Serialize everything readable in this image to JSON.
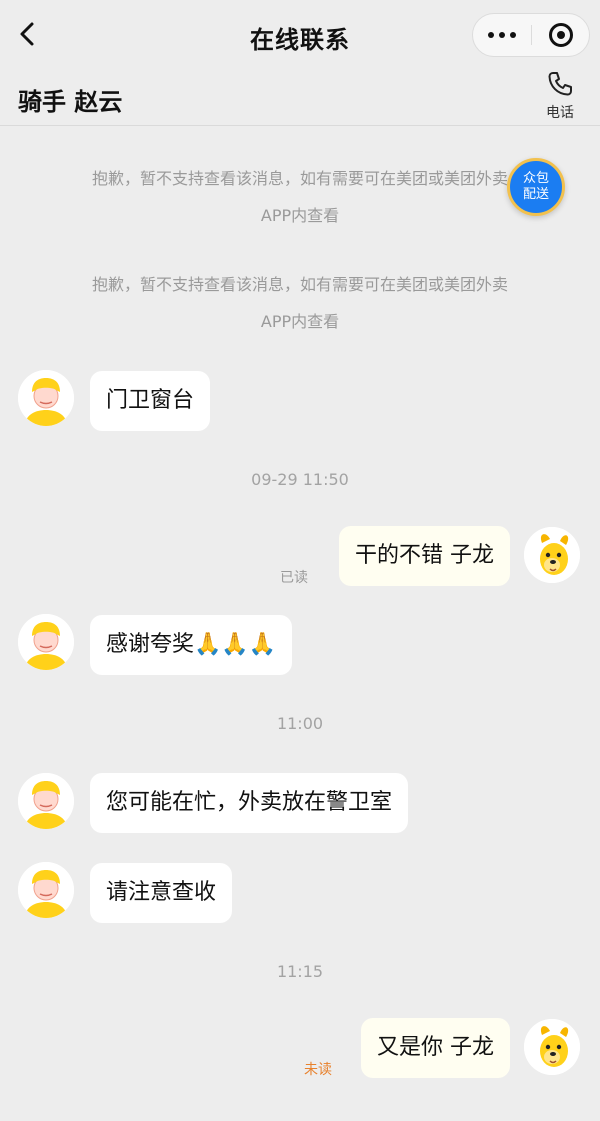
{
  "nav": {
    "title": "在线联系",
    "back_icon": "chevron-left-icon",
    "more_icon": "more-dots-icon",
    "close_icon": "target-close-icon"
  },
  "header": {
    "rider_name": "骑手 赵云",
    "phone_label": "电话",
    "phone_icon": "phone-icon"
  },
  "float_badge": {
    "line1": "众包",
    "line2": "配送",
    "color": "#1b7df2"
  },
  "system_messages": [
    {
      "line1": "抱歉，暂不支持查看该消息，如有需要可在美团或美团外卖",
      "line2": "APP内查看"
    },
    {
      "line1": "抱歉，暂不支持查看该消息，如有需要可在美团或美团外卖",
      "line2": "APP内查看"
    }
  ],
  "timestamps": [
    "09-29 11:50",
    "11:00",
    "11:15"
  ],
  "messages": [
    {
      "sender": "rider",
      "text": "门卫窗台"
    },
    {
      "sender": "me",
      "text": "干的不错 子龙",
      "status": "已读"
    },
    {
      "sender": "rider",
      "text": "感谢夸奖🙏🙏🙏"
    },
    {
      "sender": "rider",
      "text": "您可能在忙，外卖放在警卫室"
    },
    {
      "sender": "rider",
      "text": "请注意查收"
    },
    {
      "sender": "me",
      "text": "又是你 子龙",
      "status": "未读"
    }
  ],
  "colors": {
    "background": "#ededed",
    "incoming_bubble": "#ffffff",
    "outgoing_bubble": "#fffef1",
    "unread_status": "#e8812c",
    "rider_helmet": "#ffd11a"
  }
}
